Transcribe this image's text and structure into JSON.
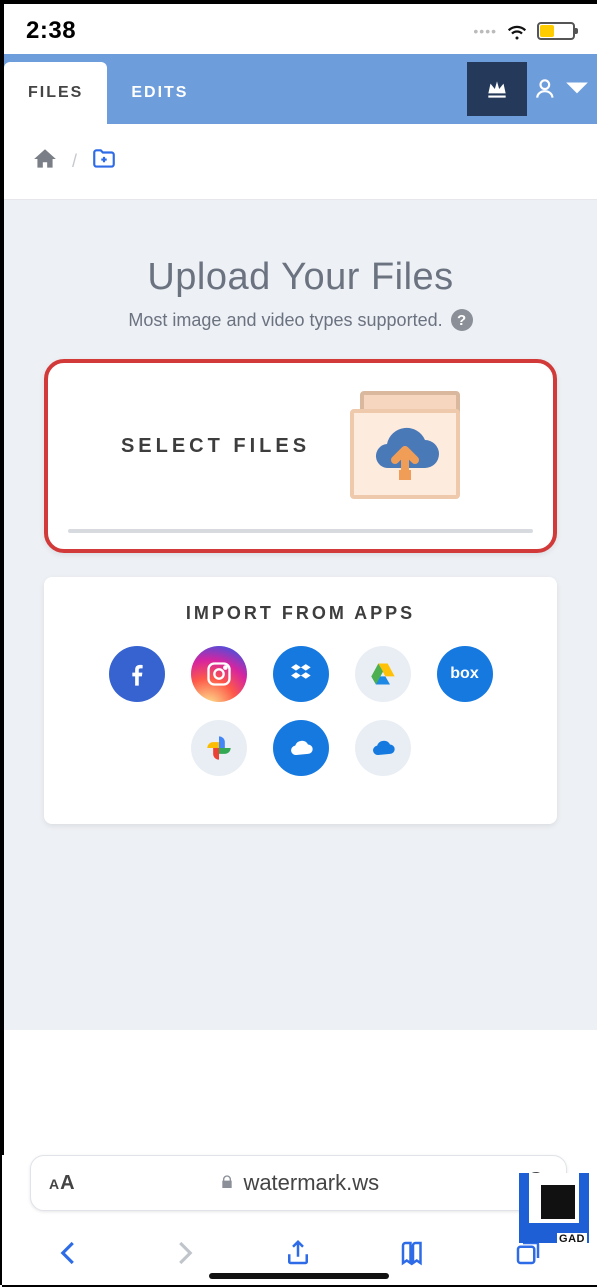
{
  "status": {
    "time": "2:38"
  },
  "tabs": {
    "files": "FILES",
    "edits": "EDITS"
  },
  "upload": {
    "title": "Upload Your Files",
    "subtitle": "Most image and video types supported.",
    "select_label": "SELECT FILES"
  },
  "import": {
    "title": "IMPORT FROM APPS",
    "apps_row1": [
      "facebook",
      "instagram",
      "dropbox",
      "gdrive",
      "box"
    ],
    "apps_row2": [
      "gphotos",
      "onedrive",
      "onedrive-alt"
    ],
    "box_label": "box"
  },
  "browser": {
    "url": "watermark.ws"
  },
  "corner": {
    "tag": "GAD"
  }
}
